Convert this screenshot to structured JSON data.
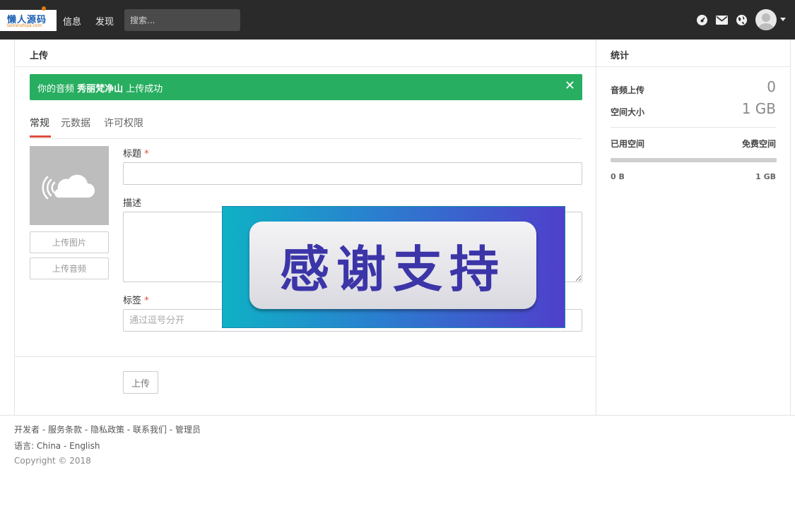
{
  "brand": {
    "logo_text": "懒人源码",
    "logo_sub": "lanrenzhijia.com"
  },
  "nav": {
    "info": "信息",
    "discover": "发现"
  },
  "search": {
    "placeholder": "搜索..."
  },
  "main": {
    "title": "上传",
    "alert": {
      "prefix": "你的音频 ",
      "name": "秀丽梵净山",
      "suffix": " 上传成功",
      "close": "✕"
    },
    "tabs": [
      "常规",
      "元数据",
      "许可权限"
    ],
    "buttons": {
      "upload_image": "上传图片",
      "upload_audio": "上传音频",
      "submit": "上传"
    },
    "fields": {
      "title_label": "标题",
      "desc_label": "描述",
      "tags_label": "标签",
      "tags_placeholder": "通过逗号分开",
      "required": "*"
    },
    "banner": "感谢支持"
  },
  "stats": {
    "title": "统计",
    "uploads_label": "音频上传",
    "uploads_value": "0",
    "space_label": "空间大小",
    "space_value": "1 GB",
    "used_label": "已用空间",
    "free_label": "免费空间",
    "used_amount": "0 B",
    "total_amount": "1 GB",
    "used_fraction": 0
  },
  "footer": {
    "links": [
      "开发者",
      "服务条款",
      "隐私政策",
      "联系我们",
      "管理员"
    ],
    "separator": " - ",
    "language_label": "语言:",
    "languages": [
      "China",
      "English"
    ],
    "copyright": "Copyright © 2018"
  }
}
